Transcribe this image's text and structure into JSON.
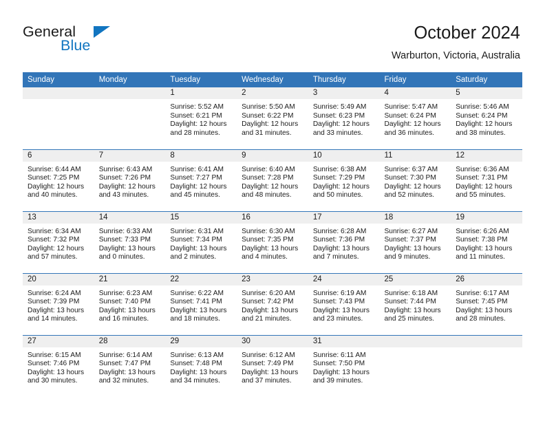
{
  "brand": {
    "name_part1": "General",
    "name_part2": "Blue",
    "accent_color": "#1175c0"
  },
  "header": {
    "title": "October 2024",
    "subtitle": "Warburton, Victoria, Australia"
  },
  "calendar": {
    "header_bg": "#3275b8",
    "daynum_bg": "#efefef",
    "weekday_headers": [
      "Sunday",
      "Monday",
      "Tuesday",
      "Wednesday",
      "Thursday",
      "Friday",
      "Saturday"
    ],
    "weeks": [
      [
        {
          "day": "",
          "sunrise": "",
          "sunset": "",
          "daylight_1": "",
          "daylight_2": ""
        },
        {
          "day": "",
          "sunrise": "",
          "sunset": "",
          "daylight_1": "",
          "daylight_2": ""
        },
        {
          "day": "1",
          "sunrise": "Sunrise: 5:52 AM",
          "sunset": "Sunset: 6:21 PM",
          "daylight_1": "Daylight: 12 hours",
          "daylight_2": "and 28 minutes."
        },
        {
          "day": "2",
          "sunrise": "Sunrise: 5:50 AM",
          "sunset": "Sunset: 6:22 PM",
          "daylight_1": "Daylight: 12 hours",
          "daylight_2": "and 31 minutes."
        },
        {
          "day": "3",
          "sunrise": "Sunrise: 5:49 AM",
          "sunset": "Sunset: 6:23 PM",
          "daylight_1": "Daylight: 12 hours",
          "daylight_2": "and 33 minutes."
        },
        {
          "day": "4",
          "sunrise": "Sunrise: 5:47 AM",
          "sunset": "Sunset: 6:24 PM",
          "daylight_1": "Daylight: 12 hours",
          "daylight_2": "and 36 minutes."
        },
        {
          "day": "5",
          "sunrise": "Sunrise: 5:46 AM",
          "sunset": "Sunset: 6:24 PM",
          "daylight_1": "Daylight: 12 hours",
          "daylight_2": "and 38 minutes."
        }
      ],
      [
        {
          "day": "6",
          "sunrise": "Sunrise: 6:44 AM",
          "sunset": "Sunset: 7:25 PM",
          "daylight_1": "Daylight: 12 hours",
          "daylight_2": "and 40 minutes."
        },
        {
          "day": "7",
          "sunrise": "Sunrise: 6:43 AM",
          "sunset": "Sunset: 7:26 PM",
          "daylight_1": "Daylight: 12 hours",
          "daylight_2": "and 43 minutes."
        },
        {
          "day": "8",
          "sunrise": "Sunrise: 6:41 AM",
          "sunset": "Sunset: 7:27 PM",
          "daylight_1": "Daylight: 12 hours",
          "daylight_2": "and 45 minutes."
        },
        {
          "day": "9",
          "sunrise": "Sunrise: 6:40 AM",
          "sunset": "Sunset: 7:28 PM",
          "daylight_1": "Daylight: 12 hours",
          "daylight_2": "and 48 minutes."
        },
        {
          "day": "10",
          "sunrise": "Sunrise: 6:38 AM",
          "sunset": "Sunset: 7:29 PM",
          "daylight_1": "Daylight: 12 hours",
          "daylight_2": "and 50 minutes."
        },
        {
          "day": "11",
          "sunrise": "Sunrise: 6:37 AM",
          "sunset": "Sunset: 7:30 PM",
          "daylight_1": "Daylight: 12 hours",
          "daylight_2": "and 52 minutes."
        },
        {
          "day": "12",
          "sunrise": "Sunrise: 6:36 AM",
          "sunset": "Sunset: 7:31 PM",
          "daylight_1": "Daylight: 12 hours",
          "daylight_2": "and 55 minutes."
        }
      ],
      [
        {
          "day": "13",
          "sunrise": "Sunrise: 6:34 AM",
          "sunset": "Sunset: 7:32 PM",
          "daylight_1": "Daylight: 12 hours",
          "daylight_2": "and 57 minutes."
        },
        {
          "day": "14",
          "sunrise": "Sunrise: 6:33 AM",
          "sunset": "Sunset: 7:33 PM",
          "daylight_1": "Daylight: 13 hours",
          "daylight_2": "and 0 minutes."
        },
        {
          "day": "15",
          "sunrise": "Sunrise: 6:31 AM",
          "sunset": "Sunset: 7:34 PM",
          "daylight_1": "Daylight: 13 hours",
          "daylight_2": "and 2 minutes."
        },
        {
          "day": "16",
          "sunrise": "Sunrise: 6:30 AM",
          "sunset": "Sunset: 7:35 PM",
          "daylight_1": "Daylight: 13 hours",
          "daylight_2": "and 4 minutes."
        },
        {
          "day": "17",
          "sunrise": "Sunrise: 6:28 AM",
          "sunset": "Sunset: 7:36 PM",
          "daylight_1": "Daylight: 13 hours",
          "daylight_2": "and 7 minutes."
        },
        {
          "day": "18",
          "sunrise": "Sunrise: 6:27 AM",
          "sunset": "Sunset: 7:37 PM",
          "daylight_1": "Daylight: 13 hours",
          "daylight_2": "and 9 minutes."
        },
        {
          "day": "19",
          "sunrise": "Sunrise: 6:26 AM",
          "sunset": "Sunset: 7:38 PM",
          "daylight_1": "Daylight: 13 hours",
          "daylight_2": "and 11 minutes."
        }
      ],
      [
        {
          "day": "20",
          "sunrise": "Sunrise: 6:24 AM",
          "sunset": "Sunset: 7:39 PM",
          "daylight_1": "Daylight: 13 hours",
          "daylight_2": "and 14 minutes."
        },
        {
          "day": "21",
          "sunrise": "Sunrise: 6:23 AM",
          "sunset": "Sunset: 7:40 PM",
          "daylight_1": "Daylight: 13 hours",
          "daylight_2": "and 16 minutes."
        },
        {
          "day": "22",
          "sunrise": "Sunrise: 6:22 AM",
          "sunset": "Sunset: 7:41 PM",
          "daylight_1": "Daylight: 13 hours",
          "daylight_2": "and 18 minutes."
        },
        {
          "day": "23",
          "sunrise": "Sunrise: 6:20 AM",
          "sunset": "Sunset: 7:42 PM",
          "daylight_1": "Daylight: 13 hours",
          "daylight_2": "and 21 minutes."
        },
        {
          "day": "24",
          "sunrise": "Sunrise: 6:19 AM",
          "sunset": "Sunset: 7:43 PM",
          "daylight_1": "Daylight: 13 hours",
          "daylight_2": "and 23 minutes."
        },
        {
          "day": "25",
          "sunrise": "Sunrise: 6:18 AM",
          "sunset": "Sunset: 7:44 PM",
          "daylight_1": "Daylight: 13 hours",
          "daylight_2": "and 25 minutes."
        },
        {
          "day": "26",
          "sunrise": "Sunrise: 6:17 AM",
          "sunset": "Sunset: 7:45 PM",
          "daylight_1": "Daylight: 13 hours",
          "daylight_2": "and 28 minutes."
        }
      ],
      [
        {
          "day": "27",
          "sunrise": "Sunrise: 6:15 AM",
          "sunset": "Sunset: 7:46 PM",
          "daylight_1": "Daylight: 13 hours",
          "daylight_2": "and 30 minutes."
        },
        {
          "day": "28",
          "sunrise": "Sunrise: 6:14 AM",
          "sunset": "Sunset: 7:47 PM",
          "daylight_1": "Daylight: 13 hours",
          "daylight_2": "and 32 minutes."
        },
        {
          "day": "29",
          "sunrise": "Sunrise: 6:13 AM",
          "sunset": "Sunset: 7:48 PM",
          "daylight_1": "Daylight: 13 hours",
          "daylight_2": "and 34 minutes."
        },
        {
          "day": "30",
          "sunrise": "Sunrise: 6:12 AM",
          "sunset": "Sunset: 7:49 PM",
          "daylight_1": "Daylight: 13 hours",
          "daylight_2": "and 37 minutes."
        },
        {
          "day": "31",
          "sunrise": "Sunrise: 6:11 AM",
          "sunset": "Sunset: 7:50 PM",
          "daylight_1": "Daylight: 13 hours",
          "daylight_2": "and 39 minutes."
        },
        {
          "day": "",
          "sunrise": "",
          "sunset": "",
          "daylight_1": "",
          "daylight_2": ""
        },
        {
          "day": "",
          "sunrise": "",
          "sunset": "",
          "daylight_1": "",
          "daylight_2": ""
        }
      ]
    ]
  }
}
